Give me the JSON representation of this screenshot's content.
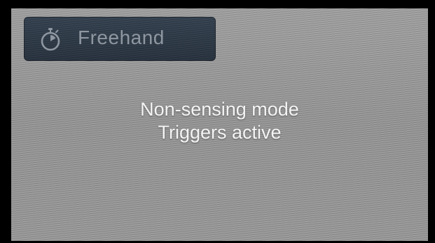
{
  "screen": {
    "mode_badge": {
      "icon": "stopwatch-icon",
      "label": "Freehand"
    },
    "status_lines": [
      "Non-sensing mode",
      "Triggers active"
    ]
  },
  "colors": {
    "frame": "#000000",
    "screen_background": "#9b9b9b",
    "badge_background": "#2b3745",
    "badge_text": "#8e97a1",
    "status_text": "#f4f4f4"
  }
}
